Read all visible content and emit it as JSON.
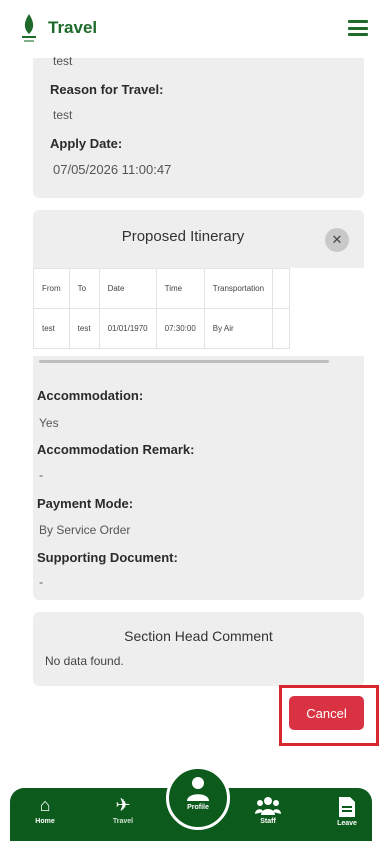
{
  "header": {
    "title": "Travel"
  },
  "details": {
    "partial_value": "test",
    "reason_label": "Reason for Travel:",
    "reason_value": "test",
    "apply_label": "Apply Date:",
    "apply_value": "07/05/2026 11:00:47"
  },
  "itinerary": {
    "title": "Proposed Itinerary",
    "close_icon": "close-icon",
    "columns": [
      "From",
      "To",
      "Date",
      "Time",
      "Transportation"
    ],
    "rows": [
      [
        "test",
        "test",
        "01/01/1970",
        "07:30:00",
        "By Air"
      ]
    ]
  },
  "accommodation": {
    "label": "Accommodation:",
    "value": "Yes"
  },
  "accommodation_remark": {
    "label": "Accommodation Remark:",
    "value": "-"
  },
  "payment_mode": {
    "label": "Payment Mode:",
    "value": "By Service Order"
  },
  "supporting_document": {
    "label": "Supporting Document:",
    "value": "-"
  },
  "section_head": {
    "title": "Section Head Comment",
    "text": "No data found."
  },
  "actions": {
    "cancel_label": "Cancel",
    "highlight_color": "#d7262e"
  },
  "nav": {
    "items": [
      {
        "label": "Home",
        "icon": "home-icon"
      },
      {
        "label": "Travel",
        "icon": "airplane-icon"
      },
      {
        "label": "Profile",
        "icon": "user-icon"
      },
      {
        "label": "Staff",
        "icon": "users-icon"
      },
      {
        "label": "Leave",
        "icon": "document-icon"
      }
    ]
  },
  "colors": {
    "brand": "#1d6a2b",
    "nav_bg": "#0c5a1c",
    "danger": "#d93343"
  }
}
